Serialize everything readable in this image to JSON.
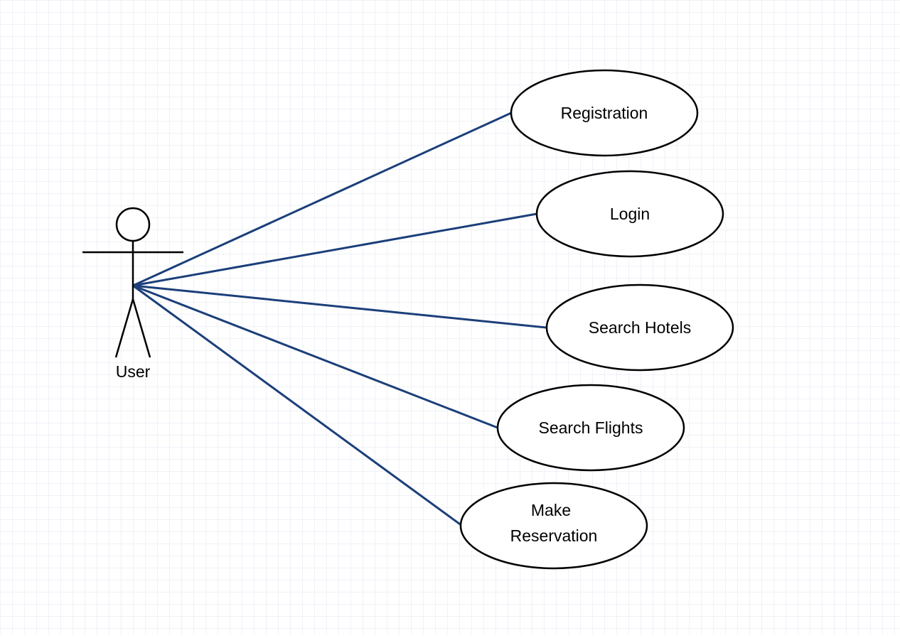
{
  "diagram": {
    "actor": {
      "label": "User"
    },
    "use_cases": [
      {
        "id": "registration",
        "lines": [
          "Registration"
        ]
      },
      {
        "id": "login",
        "lines": [
          "Login"
        ]
      },
      {
        "id": "search-hotels",
        "lines": [
          "Search Hotels"
        ]
      },
      {
        "id": "search-flights",
        "lines": [
          "Search Flights"
        ]
      },
      {
        "id": "make-reservation",
        "lines": [
          "Make",
          "Reservation"
        ]
      }
    ]
  },
  "colors": {
    "association_line": "#1b3f7a",
    "outline": "#000000",
    "grid": "#e2e5f2",
    "background": "#ffffff"
  }
}
